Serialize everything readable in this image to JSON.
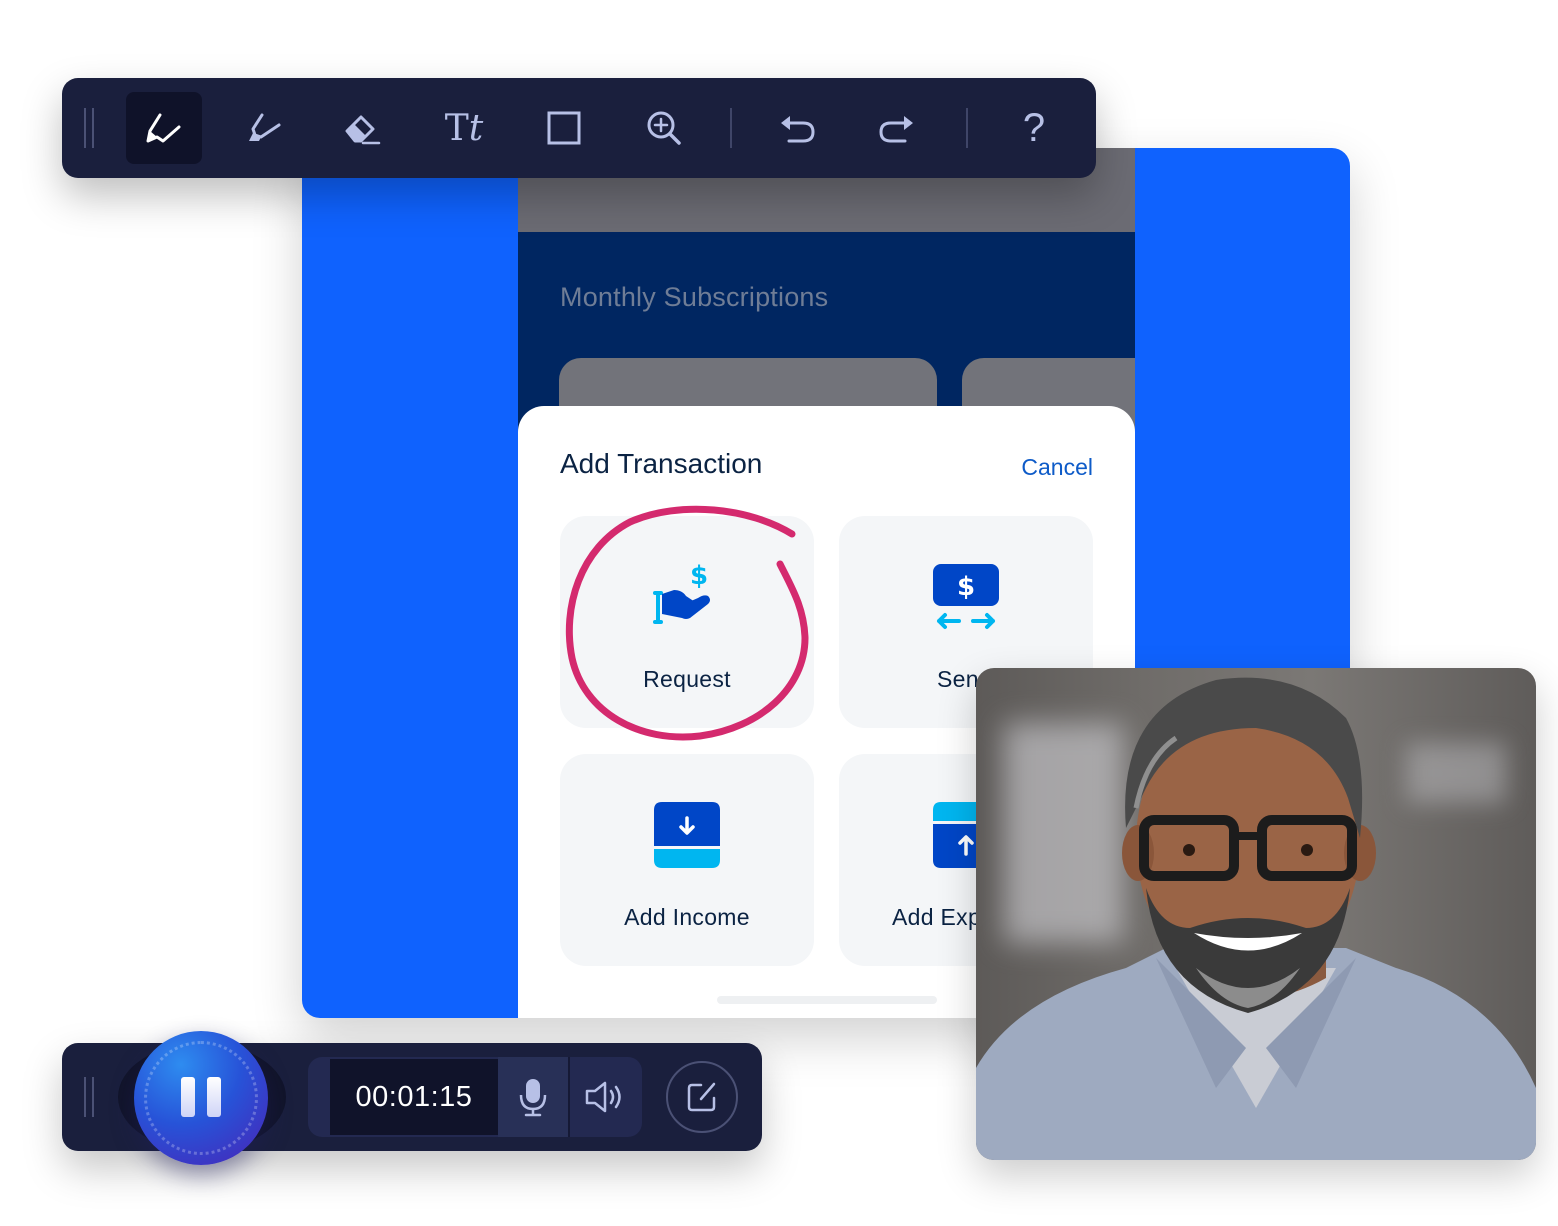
{
  "toolbar": {
    "tools": [
      {
        "name": "pen",
        "icon": "pen-icon",
        "active": true
      },
      {
        "name": "highlighter",
        "icon": "highlighter-icon",
        "active": false
      },
      {
        "name": "eraser",
        "icon": "eraser-icon",
        "active": false
      },
      {
        "name": "text",
        "icon": "text-icon",
        "label": "Tt",
        "active": false
      },
      {
        "name": "rectangle",
        "icon": "rectangle-icon",
        "active": false
      },
      {
        "name": "zoom-in",
        "icon": "zoom-in-icon",
        "active": false
      },
      {
        "name": "undo",
        "icon": "undo-icon",
        "active": false
      },
      {
        "name": "redo",
        "icon": "redo-icon",
        "active": false
      },
      {
        "name": "help",
        "icon": "help-icon",
        "label": "?",
        "active": false
      }
    ],
    "text_tool_label_main": "T",
    "text_tool_label_italic": "t",
    "help_label": "?"
  },
  "app": {
    "section_title": "Monthly Subscriptions",
    "sheet": {
      "title": "Add Transaction",
      "cancel_label": "Cancel",
      "options": [
        {
          "label": "Request",
          "icon": "request-money-icon",
          "annotated": true
        },
        {
          "label": "Send",
          "icon": "send-money-icon",
          "visible_label": "Sen"
        },
        {
          "label": "Add Income",
          "icon": "add-income-icon"
        },
        {
          "label": "Add Expense",
          "icon": "add-expense-icon",
          "visible_label": "Add Exp"
        }
      ]
    }
  },
  "recorder": {
    "state": "recording",
    "elapsed_time": "00:01:15",
    "mic": "mic-icon",
    "speaker": "speaker-icon",
    "edit": "edit-icon"
  },
  "webcam": {
    "description": "Presenter webcam feed"
  },
  "colors": {
    "brand_blue": "#0f62fe",
    "app_navy": "#002661",
    "toolbar_bg": "#1a1f3d",
    "annotation_pink": "#d42a6e",
    "icon_dark_blue": "#0046c7",
    "icon_light_blue": "#00b6f0",
    "cancel_blue": "#0e5bc8"
  }
}
